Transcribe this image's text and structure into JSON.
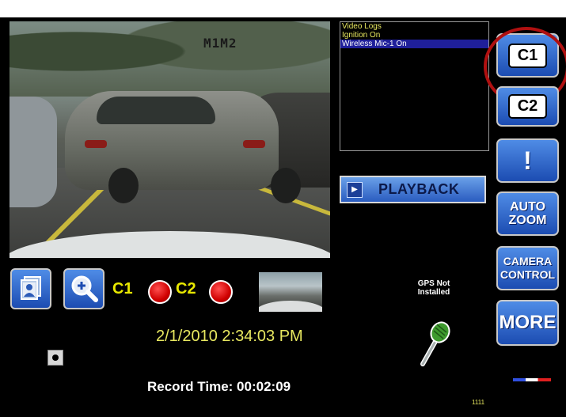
{
  "camera_feed": {
    "overlay_text": "M1M2"
  },
  "log_list": {
    "items": [
      {
        "label": "Video Logs",
        "selected": false
      },
      {
        "label": "Ignition On",
        "selected": false
      },
      {
        "label": "Wireless Mic-1 On",
        "selected": true
      }
    ]
  },
  "playback": {
    "label": "PLAYBACK",
    "icon": "play-icon"
  },
  "right_buttons": {
    "c1": "C1",
    "c2": "C2",
    "alert_icon": "exclamation-icon",
    "auto_zoom": [
      "AUTO",
      "ZOOM"
    ],
    "camera_control": [
      "CAMERA",
      "CONTROL"
    ],
    "more": "MORE"
  },
  "bottom_controls": {
    "snapshot_icon": "photo-stack-icon",
    "zoom_icon": "magnify-plus-icon",
    "c1_label": "C1",
    "c2_label": "C2"
  },
  "gps": [
    "GPS Not",
    "Installed"
  ],
  "datetime": "2/1/2010 2:34:03 PM",
  "record_time": "Record Time: 00:02:09",
  "code": "1111",
  "colors": {
    "accent_blue": "#2a5cc0",
    "label_yellow": "#e8e860",
    "highlight_red": "#b01010"
  }
}
